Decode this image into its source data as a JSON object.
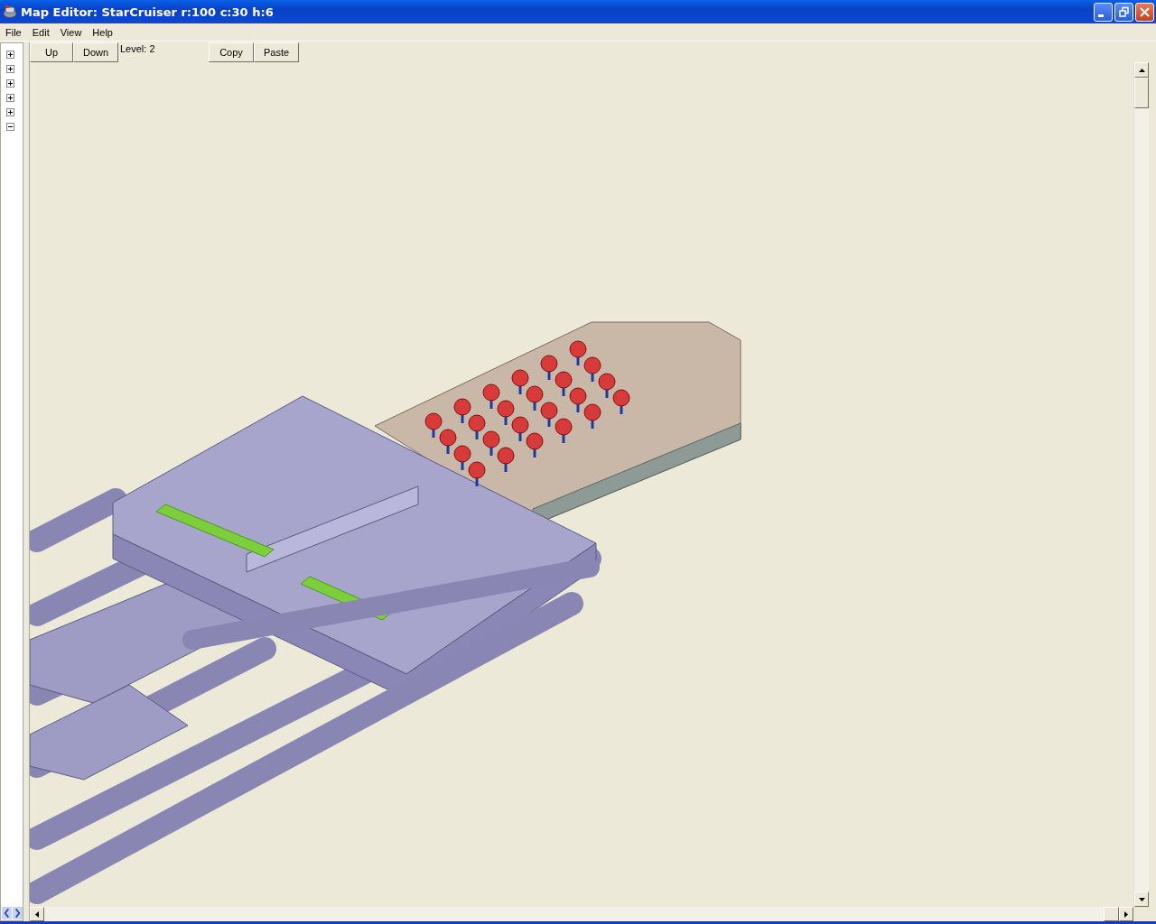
{
  "window": {
    "title": "Map Editor: StarCruiser r:100 c:30 h:6"
  },
  "menu": [
    {
      "label": "File"
    },
    {
      "label": "Edit"
    },
    {
      "label": "View"
    },
    {
      "label": "Help"
    }
  ],
  "tree": {
    "nodes": [
      {
        "expanded": false
      },
      {
        "expanded": false
      },
      {
        "expanded": false
      },
      {
        "expanded": false
      },
      {
        "expanded": false
      },
      {
        "expanded": true
      }
    ]
  },
  "toolbar": {
    "level_buttons": [
      "Up",
      "Down"
    ],
    "level_label": "Level: 2",
    "clipboard_buttons": [
      "Copy",
      "Paste"
    ]
  }
}
